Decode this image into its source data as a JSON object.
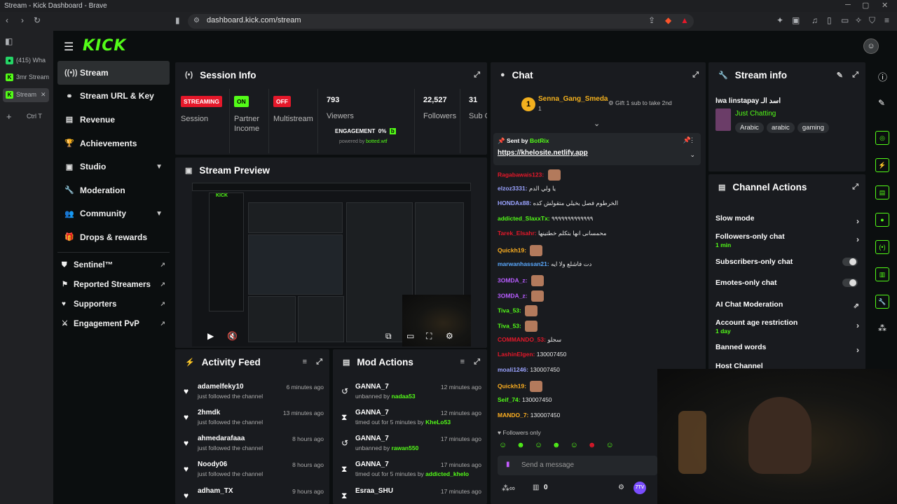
{
  "window": {
    "title": "Stream - Kick Dashboard - Brave"
  },
  "browser": {
    "url": "dashboard.kick.com/stream"
  },
  "tabs": [
    {
      "label": "(415) Wha"
    },
    {
      "label": "3mr Stream"
    },
    {
      "label": "Stream"
    }
  ],
  "tabs_extra": {
    "shortcut": "Ctrl T"
  },
  "brand": {
    "logo": "KICK",
    "accent": "#53fc18"
  },
  "sidebar": {
    "items": [
      {
        "label": "Stream",
        "icon": "broadcast-icon"
      },
      {
        "label": "Stream URL & Key",
        "icon": "link-icon"
      },
      {
        "label": "Revenue",
        "icon": "revenue-icon"
      },
      {
        "label": "Achievements",
        "icon": "trophy-icon"
      },
      {
        "label": "Studio",
        "icon": "studio-icon"
      },
      {
        "label": "Moderation",
        "icon": "wrench-icon"
      },
      {
        "label": "Community",
        "icon": "users-icon"
      },
      {
        "label": "Drops & rewards",
        "icon": "gift-icon"
      }
    ],
    "sub_items": [
      {
        "label": "Sentinel™"
      },
      {
        "label": "Reported Streamers"
      },
      {
        "label": "Supporters"
      },
      {
        "label": "Engagement PvP"
      }
    ]
  },
  "session": {
    "title": "Session Info",
    "stats": [
      {
        "badge": "STREAMING",
        "label": "Session"
      },
      {
        "badge": "ON",
        "label": "Partner Income"
      },
      {
        "badge": "OFF",
        "label": "Multistream"
      },
      {
        "value": "793",
        "label": "Viewers"
      },
      {
        "value": "22,527",
        "label": "Followers"
      },
      {
        "value": "31",
        "label": "Sub Count"
      }
    ],
    "engagement": {
      "label": "ENGAGEMENT",
      "value": "0%",
      "powered": "powered by",
      "brand": "botted.wtf"
    }
  },
  "preview": {
    "title": "Stream Preview"
  },
  "activity": {
    "title": "Activity Feed",
    "items": [
      {
        "name": "adamelfeky10",
        "action": "just followed the channel",
        "time": "6 minutes ago"
      },
      {
        "name": "2hmdk",
        "action": "just followed the channel",
        "time": "13 minutes ago"
      },
      {
        "name": "ahmedarafaaa",
        "action": "just followed the channel",
        "time": "8 hours ago"
      },
      {
        "name": "Noody06",
        "action": "just followed the channel",
        "time": "8 hours ago"
      },
      {
        "name": "adham_TX",
        "action": "",
        "time": "9 hours ago"
      }
    ]
  },
  "mod": {
    "title": "Mod Actions",
    "items": [
      {
        "name": "GANNA_7",
        "action": "unbanned by",
        "by": "nadaa53",
        "time": "12 minutes ago"
      },
      {
        "name": "GANNA_7",
        "action": "timed out for 5 minutes by",
        "by": "KheLo53",
        "time": "12 minutes ago"
      },
      {
        "name": "GANNA_7",
        "action": "unbanned by",
        "by": "rawan550",
        "time": "17 minutes ago"
      },
      {
        "name": "GANNA_7",
        "action": "timed out for 5 minutes by",
        "by": "addicted_khelo",
        "time": "17 minutes ago"
      },
      {
        "name": "Esraa_SHU",
        "action": "",
        "by": "",
        "time": "17 minutes ago"
      }
    ]
  },
  "chat": {
    "title": "Chat",
    "top_gifter": {
      "rank": "1",
      "name": "Senna_Gang_Smeda",
      "count": "1"
    },
    "gift_cta": "Gift 1 sub to take 2nd",
    "pinned": {
      "prefix": "Sent by",
      "author": "BotRix",
      "link": "https://khelosite.netlify.app"
    },
    "messages": [
      {
        "user": "Ragabawais123:",
        "text": "",
        "color": "#e5182a"
      },
      {
        "user": "elzoz3331:",
        "text": "يا ولي الدم",
        "color": "#9aa3ff"
      },
      {
        "user": "HONDAx88:",
        "text": "الخرطوم فصل بخيلي متقولش كده",
        "color": "#9aa3ff"
      },
      {
        "user": "addicted_SlaxxTx:",
        "text": "٩٩٩٩٩٩٩٩٩٩٩٩٩",
        "color": "#53fc18"
      },
      {
        "user": "Tarek_Elsahr:",
        "text": "محمسانى انها بتكلم خطتينها",
        "color": "#e5182a"
      },
      {
        "user": "Quickh19:",
        "text": "",
        "color": "#ffb020"
      },
      {
        "user": "marwanhassan21:",
        "text": "دت فاشلع ولا ايه",
        "color": "#5aa9ff"
      },
      {
        "user": "3OMDA_z:",
        "text": "",
        "color": "#b85cff"
      },
      {
        "user": "3OMDA_z:",
        "text": "",
        "color": "#b85cff"
      },
      {
        "user": "Tiva_53:",
        "text": "",
        "color": "#53fc18"
      },
      {
        "user": "Tiva_53:",
        "text": "",
        "color": "#53fc18"
      },
      {
        "user": "COMMANDO_53:",
        "text": "سجلو",
        "color": "#e5182a"
      },
      {
        "user": "LashinElgen:",
        "text": "130007450",
        "color": "#e5182a"
      },
      {
        "user": "moali1246:",
        "text": "130007450",
        "color": "#9aa3ff"
      },
      {
        "user": "Quickh19:",
        "text": "",
        "color": "#ffb020"
      },
      {
        "user": "Seif_74:",
        "text": "130007450",
        "color": "#53fc18"
      },
      {
        "user": "MANDO_7:",
        "text": "130007450",
        "color": "#ffb020"
      }
    ],
    "followers_only": "Followers only",
    "input_placeholder": "Send a message",
    "count": "0"
  },
  "info": {
    "title": "Stream info",
    "stream_title": "lwa linstapay اسد الـ",
    "category": "Just Chatting",
    "tags": [
      "Arabic",
      "arabic",
      "gaming"
    ]
  },
  "actions": {
    "title": "Channel Actions",
    "items": [
      {
        "label": "Slow mode",
        "sub": "",
        "control": "arrow"
      },
      {
        "label": "Followers-only chat",
        "sub": "1 min",
        "control": "arrow"
      },
      {
        "label": "Subscribers-only chat",
        "sub": "",
        "control": "toggle"
      },
      {
        "label": "Emotes-only chat",
        "sub": "",
        "control": "toggle"
      },
      {
        "label": "AI Chat Moderation",
        "sub": "",
        "control": "ext"
      },
      {
        "label": "Account age restriction",
        "sub": "1 day",
        "control": "arrow"
      },
      {
        "label": "Banned words",
        "sub": "",
        "control": "arrow"
      },
      {
        "label": "Host Channel",
        "sub": "",
        "control": "none"
      }
    ]
  },
  "right_rail": [
    "info-icon",
    "pencil-icon",
    "target-icon",
    "bolt-icon",
    "document-icon",
    "chat-icon",
    "broadcast-icon",
    "layout-icon",
    "wrench-icon",
    "apps-icon"
  ]
}
